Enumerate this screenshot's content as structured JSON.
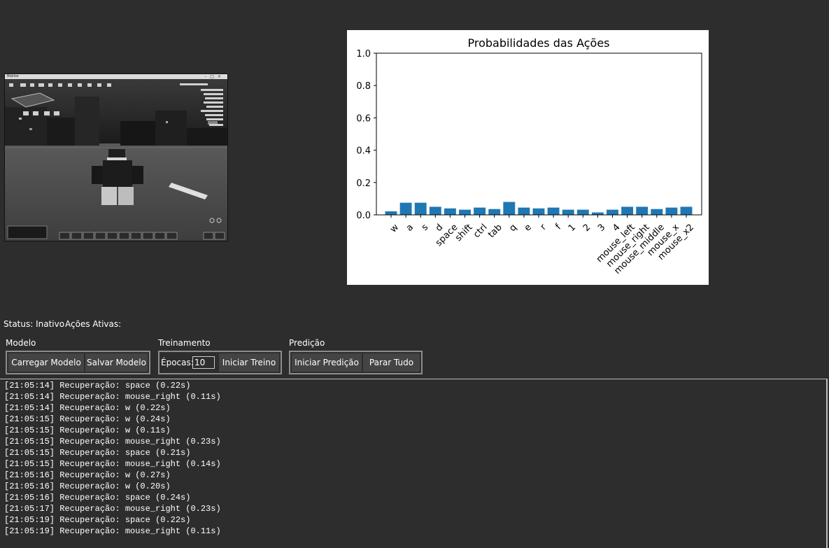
{
  "preview": {
    "window_title": "Roblox"
  },
  "chart_data": {
    "type": "bar",
    "title": "Probabilidades das Ações",
    "categories": [
      "w",
      "a",
      "s",
      "d",
      "space",
      "shift",
      "ctrl",
      "tab",
      "q",
      "e",
      "r",
      "f",
      "1",
      "2",
      "3",
      "4",
      "mouse_left",
      "mouse_right",
      "mouse_middle",
      "mouse_x",
      "mouse_x2"
    ],
    "values": [
      0.022,
      0.075,
      0.075,
      0.05,
      0.04,
      0.032,
      0.045,
      0.036,
      0.08,
      0.045,
      0.04,
      0.045,
      0.032,
      0.032,
      0.015,
      0.032,
      0.05,
      0.05,
      0.036,
      0.045,
      0.05
    ],
    "ylim": [
      0,
      1.0
    ],
    "yticks": [
      "0.0",
      "0.2",
      "0.4",
      "0.6",
      "0.8",
      "1.0"
    ],
    "bar_color": "#1f77b4"
  },
  "status": {
    "status_text": "Status: Inativo",
    "actions_text": "Ações Ativas:"
  },
  "groups": {
    "model": {
      "label": "Modelo",
      "load_button": "Carregar Modelo",
      "save_button": "Salvar Modelo"
    },
    "training": {
      "label": "Treinamento",
      "epochs_label": "Épocas:",
      "epochs_value": "10",
      "start_button": "Iniciar Treino"
    },
    "prediction": {
      "label": "Predição",
      "start_button": "Iniciar Predição",
      "stop_button": "Parar Tudo"
    }
  },
  "log": [
    "[21:05:14] Recuperação: space (0.22s)",
    "[21:05:14] Recuperação: mouse_right (0.11s)",
    "[21:05:14] Recuperação: w (0.22s)",
    "[21:05:15] Recuperação: w (0.24s)",
    "[21:05:15] Recuperação: w (0.11s)",
    "[21:05:15] Recuperação: mouse_right (0.23s)",
    "[21:05:15] Recuperação: space (0.21s)",
    "[21:05:15] Recuperação: mouse_right (0.14s)",
    "[21:05:16] Recuperação: w (0.27s)",
    "[21:05:16] Recuperação: w (0.20s)",
    "[21:05:16] Recuperação: space (0.24s)",
    "[21:05:17] Recuperação: mouse_right (0.23s)",
    "[21:05:19] Recuperação: space (0.22s)",
    "[21:05:19] Recuperação: mouse_right (0.11s)"
  ],
  "colors": {
    "background": "#2d2d2d",
    "button": "#444444",
    "group_border": "#8c8c8c"
  }
}
